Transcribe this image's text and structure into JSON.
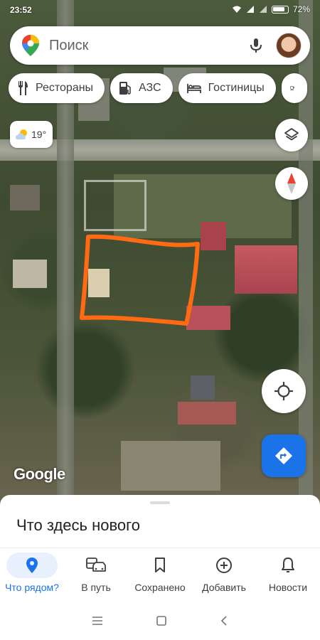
{
  "status_bar": {
    "time": "23:52",
    "battery": "72%"
  },
  "search": {
    "placeholder": "Поиск"
  },
  "chips": [
    {
      "label": "Рестораны",
      "icon": "restaurant-icon"
    },
    {
      "label": "АЗС",
      "icon": "gas-station-icon"
    },
    {
      "label": "Гостиницы",
      "icon": "hotel-icon"
    },
    {
      "label": "",
      "icon": "cafe-icon"
    }
  ],
  "weather": {
    "temperature": "19°",
    "icon": "partly-cloudy-icon"
  },
  "map": {
    "attribution": "Google",
    "annotation_color": "#ff6a13"
  },
  "sheet": {
    "title": "Что здесь нового"
  },
  "bottom_nav": [
    {
      "label": "Что рядом?",
      "icon": "location-pin-icon",
      "active": true
    },
    {
      "label": "В путь",
      "icon": "commute-icon",
      "active": false
    },
    {
      "label": "Сохранено",
      "icon": "bookmark-icon",
      "active": false
    },
    {
      "label": "Добавить",
      "icon": "add-circle-icon",
      "active": false
    },
    {
      "label": "Новости",
      "icon": "bell-icon",
      "active": false
    }
  ],
  "colors": {
    "accent": "#1a73e8",
    "active_nav_bg": "#e8f0fe"
  }
}
